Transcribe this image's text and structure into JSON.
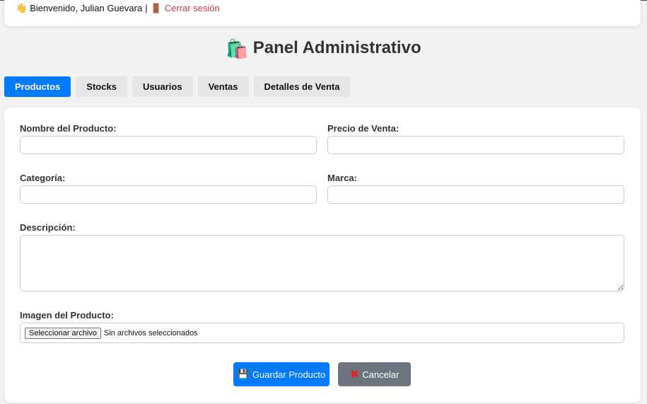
{
  "header": {
    "wave_icon": "👋",
    "welcome_text": "Bienvenido, Julian Guevara",
    "separator": "|",
    "door_icon": "🚪",
    "logout_label": "Cerrar sesión"
  },
  "page": {
    "title_icon": "🛍️",
    "title": "Panel Administrativo"
  },
  "tabs": [
    {
      "label": "Productos",
      "active": true
    },
    {
      "label": "Stocks",
      "active": false
    },
    {
      "label": "Usuarios",
      "active": false
    },
    {
      "label": "Ventas",
      "active": false
    },
    {
      "label": "Detalles de Venta",
      "active": false
    }
  ],
  "form": {
    "nombre_label": "Nombre del Producto:",
    "nombre_value": "",
    "precio_label": "Precio de Venta:",
    "precio_value": "",
    "categoria_label": "Categoría:",
    "categoria_value": "",
    "marca_label": "Marca:",
    "marca_value": "",
    "descripcion_label": "Descripción:",
    "descripcion_value": "",
    "imagen_label": "Imagen del Producto:",
    "file_button_label": "Seleccionar archivo",
    "file_status": "Sin archivos seleccionados",
    "save_icon": "💾",
    "save_label": "Guardar Producto",
    "cancel_icon": "✖",
    "cancel_label": "Cancelar"
  },
  "colors": {
    "primary": "#007bff",
    "secondary": "#6c757d",
    "logout": "#d9363e",
    "background": "#f2f2f2"
  }
}
